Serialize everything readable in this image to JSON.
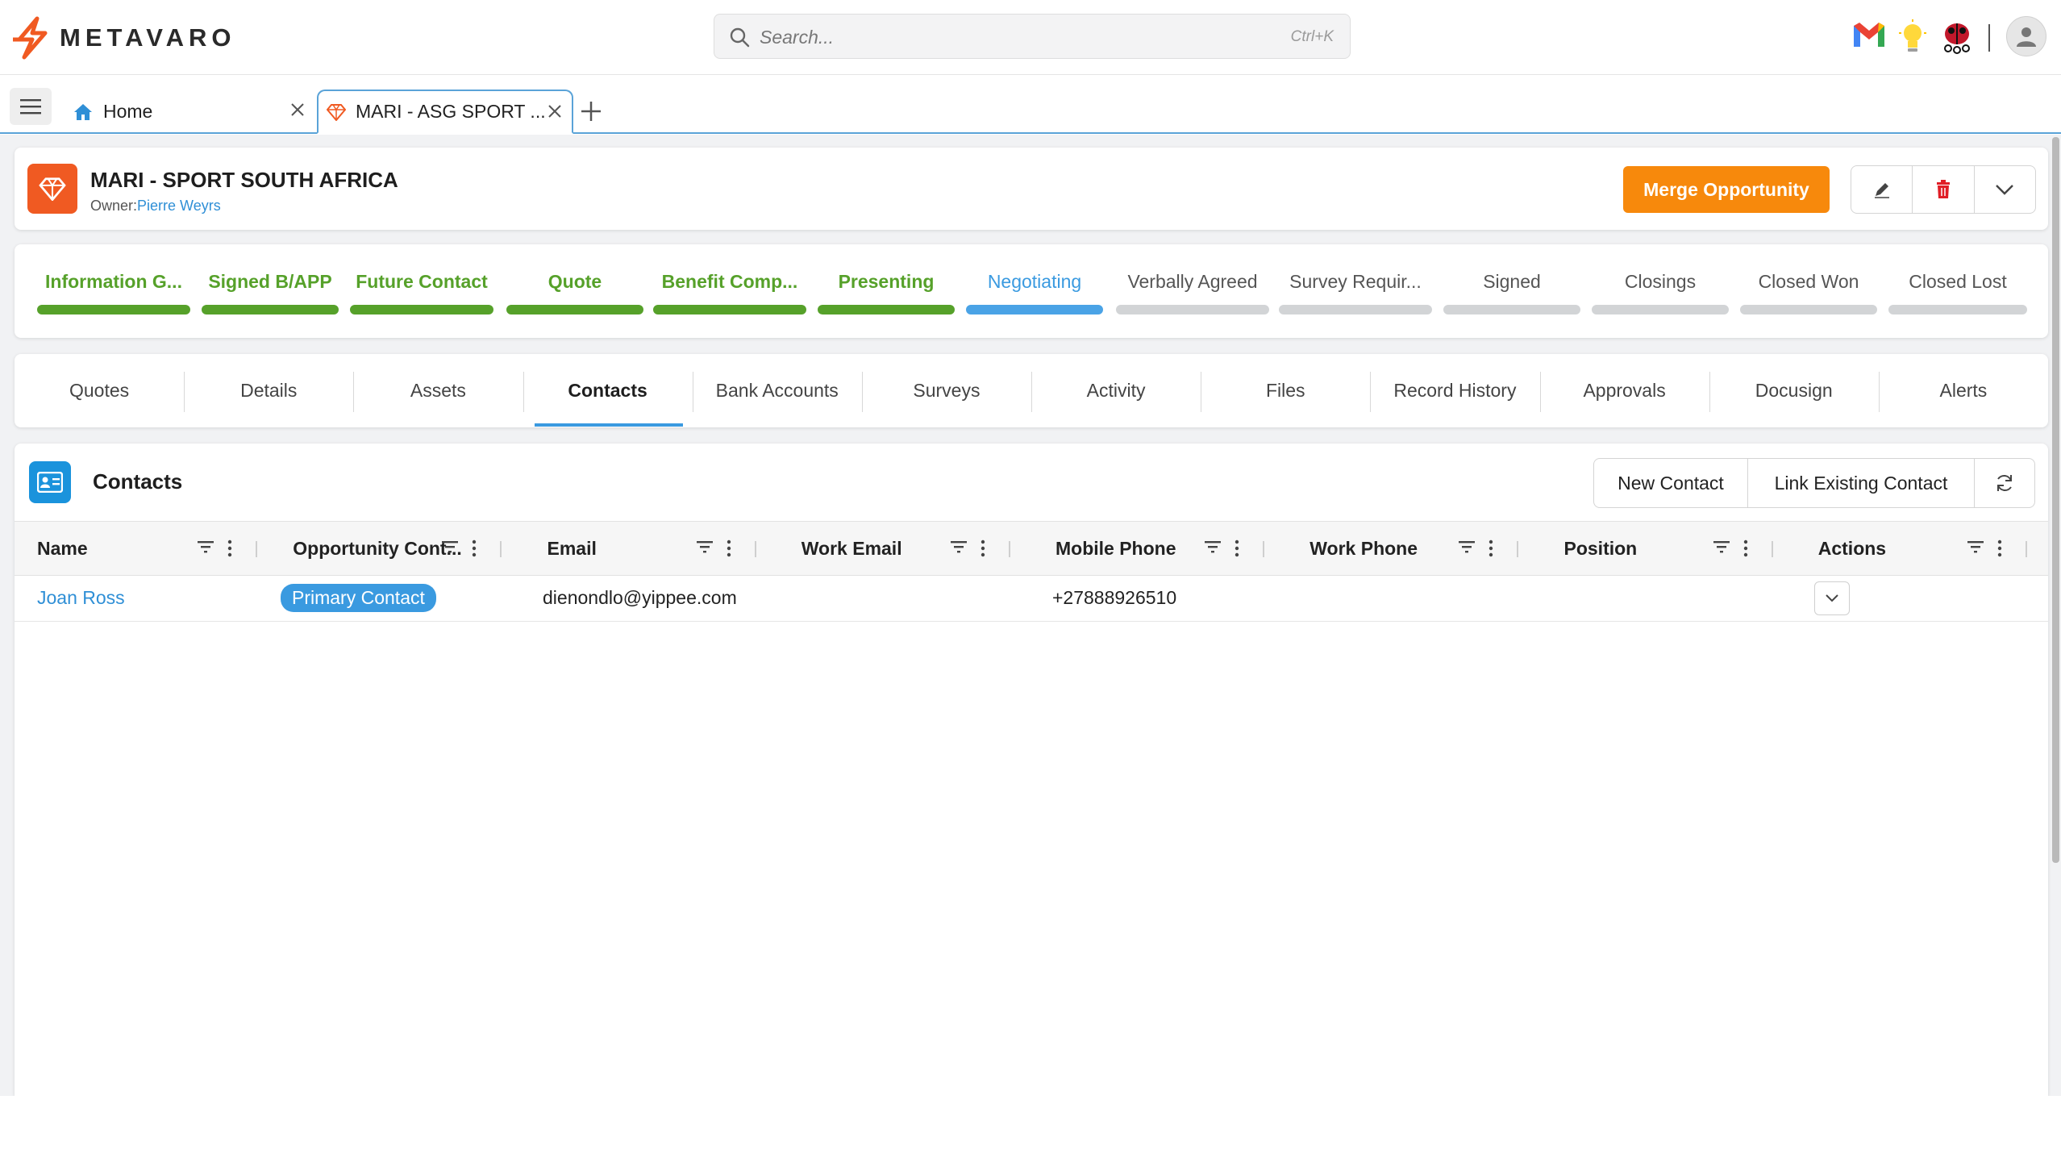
{
  "app": {
    "logo_text": "METAVARO",
    "search_placeholder": "Search...",
    "search_shortcut": "Ctrl+K"
  },
  "tabs": [
    {
      "label": "Home",
      "icon": "home-icon"
    },
    {
      "label": "MARI - ASG SPORT ...",
      "icon": "gem-icon",
      "active": true
    }
  ],
  "opportunity": {
    "title": "MARI -  SPORT SOUTH AFRICA",
    "owner_label": "Owner:",
    "owner_name": "Pierre Weyrs",
    "merge_label": "Merge Opportunity"
  },
  "stages": [
    {
      "label": "Information G...",
      "state": "done"
    },
    {
      "label": "Signed B/APP",
      "state": "done"
    },
    {
      "label": "Future Contact",
      "state": "done"
    },
    {
      "label": "Quote",
      "state": "done"
    },
    {
      "label": "Benefit Comp...",
      "state": "done"
    },
    {
      "label": "Presenting",
      "state": "done"
    },
    {
      "label": "Negotiating",
      "state": "current"
    },
    {
      "label": "Verbally Agreed",
      "state": "future"
    },
    {
      "label": "Survey Requir...",
      "state": "future"
    },
    {
      "label": "Signed",
      "state": "future"
    },
    {
      "label": "Closings",
      "state": "future"
    },
    {
      "label": "Closed Won",
      "state": "future"
    },
    {
      "label": "Closed Lost",
      "state": "future"
    }
  ],
  "sections": [
    {
      "label": "Quotes"
    },
    {
      "label": "Details"
    },
    {
      "label": "Assets"
    },
    {
      "label": "Contacts",
      "active": true
    },
    {
      "label": "Bank Accounts"
    },
    {
      "label": "Surveys"
    },
    {
      "label": "Activity"
    },
    {
      "label": "Files"
    },
    {
      "label": "Record History"
    },
    {
      "label": "Approvals"
    },
    {
      "label": "Docusign"
    },
    {
      "label": "Alerts"
    }
  ],
  "contacts": {
    "title": "Contacts",
    "new_contact_label": "New Contact",
    "link_contact_label": "Link Existing Contact",
    "columns": [
      "Name",
      "Opportunity Cont...",
      "Email",
      "Work Email",
      "Mobile Phone",
      "Work Phone",
      "Position",
      "Actions"
    ],
    "rows": [
      {
        "name": "Joan Ross",
        "role": "Primary Contact",
        "email": "dienondlo@yippee.com",
        "work_email": "",
        "mobile": "+27888926510",
        "work_phone": "",
        "position": ""
      }
    ]
  },
  "colors": {
    "brand_orange": "#f05a22",
    "merge_orange": "#f7890c",
    "stage_done": "#56a12a",
    "stage_current": "#4aa3e6",
    "stage_future": "#d2d4d6",
    "link_blue": "#2f8fd6"
  }
}
